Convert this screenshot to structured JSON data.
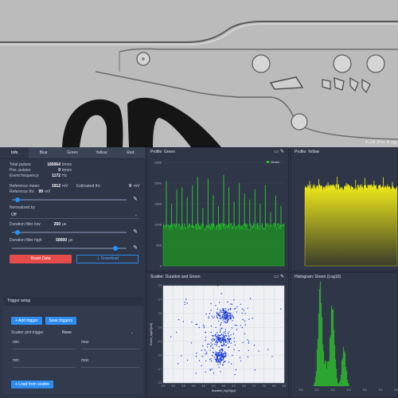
{
  "camera": {
    "stamp": "4:29 Pro 8 ug"
  },
  "tabs": [
    "Info",
    "Blue",
    "Green",
    "Yellow",
    "Red"
  ],
  "info": {
    "total_pulses": {
      "label": "Total pulses:",
      "value": "165064",
      "unit": "times"
    },
    "pos_pulses": {
      "label": "Pos. pulses:",
      "value": "0",
      "unit": "times"
    },
    "event_frequency": {
      "label": "Event frequency:",
      "value": "1172",
      "unit": "Hz"
    },
    "reference_mean": {
      "label": "Reference mean:",
      "value": "1912",
      "unit": "mV"
    },
    "estimated_thr": {
      "label": "Estimated thr:",
      "value": "0",
      "unit": "mV"
    },
    "reference_thr": {
      "label": "Reference thr:",
      "value": "99",
      "unit": "mV"
    },
    "normalized_by": {
      "label": "Normalized by",
      "value": "Off"
    },
    "duration_low": {
      "label": "Duration filter low",
      "value": "250",
      "unit": "µs"
    },
    "duration_high": {
      "label": "Duration filter high",
      "value": "50000",
      "unit": "µs"
    },
    "reset_label": "Reset Data",
    "download_label": "⇣ Download"
  },
  "sliders": {
    "reference_thr": 0.05,
    "duration_low": 0.05,
    "duration_high": 0.9
  },
  "trigger": {
    "title": "Trigger setup",
    "add_label": "+ Add trigger",
    "save_label": "Save triggers",
    "scatter_label": "Scatter plot trigger",
    "scatter_value": "None",
    "rows": [
      {
        "min": "min",
        "max": "max"
      },
      {
        "min": "min",
        "max": "max"
      }
    ],
    "load_label": "+ Load from scatter"
  },
  "panels": {
    "green": {
      "title": "Profile: Green"
    },
    "yellow": {
      "title": "Profile: Yellow"
    },
    "scatter": {
      "title": "Scatter: Duration and Green"
    },
    "hist": {
      "title": "Histogram: Green (Log10)"
    }
  },
  "colors": {
    "green": "#25c42b",
    "yellow": "#f2ec18",
    "blue": "#2d8cf0",
    "red": "#e64b4b",
    "panel_bg": "#2f3648"
  },
  "chart_data": [
    {
      "type": "line",
      "title": "Profile: Green",
      "legend": [
        "Green"
      ],
      "legend_position": "top-right",
      "yticks": [
        "2500",
        "2000",
        "1500",
        "1000",
        "500",
        "0"
      ],
      "ylim": [
        0,
        2500
      ],
      "baseline": 950,
      "spikes": [
        2050,
        1500,
        1850,
        1900,
        1650,
        1950,
        2150,
        1400,
        2100,
        1700,
        1450,
        2200,
        1900,
        1550,
        2000,
        1750,
        1600,
        1850,
        1500,
        1950,
        1300,
        1700,
        1450
      ]
    },
    {
      "type": "line",
      "title": "Profile: Yellow",
      "ylim": [
        0,
        2500
      ],
      "baseline": 1900,
      "spikes": [
        2050,
        2100,
        2020,
        2150,
        2000,
        2080,
        2120,
        2060,
        2140,
        2030
      ]
    },
    {
      "type": "scatter",
      "title": "Scatter: Duration and Green",
      "xlabel": "Duration_log10[µs]",
      "ylabel": "Green_log10[mV]",
      "xticks": [
        "2.5",
        "3.0",
        "3.5",
        "4.0",
        "4.5",
        "5.0",
        "5.5",
        "6.0",
        "6.5",
        "7.0",
        "7.5",
        "8.0",
        "8.5"
      ],
      "yticks": [
        "3.9",
        "3.7",
        "3.5",
        "3.3",
        "3.1",
        "2.9",
        "2.7",
        "2.5"
      ],
      "xlim": [
        2.5,
        8.5
      ],
      "ylim": [
        2.5,
        3.9
      ],
      "clusters": [
        {
          "x": 5.6,
          "y": 3.48,
          "sx": 0.18,
          "sy": 0.05,
          "n": 140
        },
        {
          "x": 5.4,
          "y": 3.13,
          "sx": 0.2,
          "sy": 0.05,
          "n": 120
        },
        {
          "x": 5.3,
          "y": 2.88,
          "sx": 0.2,
          "sy": 0.05,
          "n": 130
        },
        {
          "x": 5.5,
          "y": 3.2,
          "sx": 1.0,
          "sy": 0.35,
          "n": 170
        }
      ]
    },
    {
      "type": "bar",
      "title": "Histogram: Green (Log10)",
      "xticks": [
        "3.0",
        "3.1",
        "3.2",
        "3.3",
        "3.4",
        "3.5",
        "3.6"
      ],
      "xlim": [
        3.0,
        3.6
      ],
      "ylim": [
        0,
        100
      ],
      "peaks": [
        {
          "x": 3.12,
          "h": 98,
          "w": 0.012
        },
        {
          "x": 3.2,
          "h": 82,
          "w": 0.012
        },
        {
          "x": 3.27,
          "h": 40,
          "w": 0.012
        },
        {
          "x": 3.16,
          "h": 22,
          "w": 0.03
        }
      ]
    }
  ]
}
